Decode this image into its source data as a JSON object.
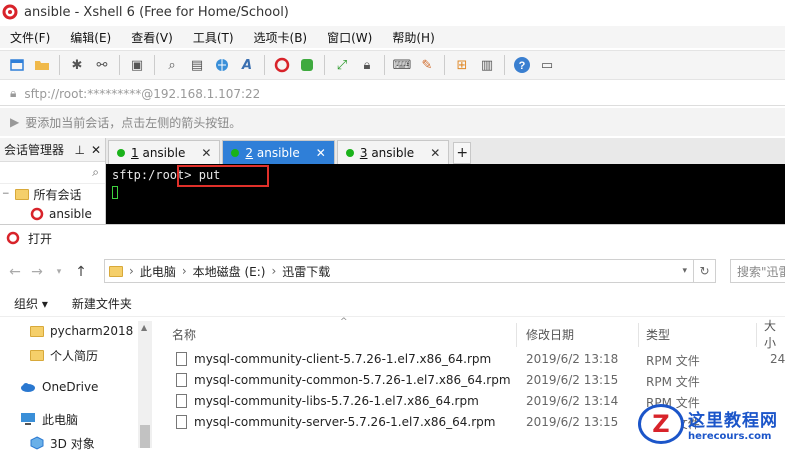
{
  "window": {
    "title": "ansible - Xshell 6 (Free for Home/School)"
  },
  "menu": [
    "文件(F)",
    "编辑(E)",
    "查看(V)",
    "工具(T)",
    "选项卡(B)",
    "窗口(W)",
    "帮助(H)"
  ],
  "address": {
    "value": "sftp://root:*********@192.168.1.107:22"
  },
  "hint": {
    "text": "要添加当前会话，点击左侧的箭头按钮。"
  },
  "session_manager": {
    "title": "会话管理器",
    "root_label": "所有会话",
    "item_label": "ansible"
  },
  "tabs": [
    {
      "num": "1",
      "label": "ansible",
      "active": false
    },
    {
      "num": "2",
      "label": "ansible",
      "active": true
    },
    {
      "num": "3",
      "label": "ansible",
      "active": false
    }
  ],
  "terminal": {
    "prompt": "sftp:/root>",
    "command": "put"
  },
  "dialog": {
    "title": "打开",
    "path": [
      "此电脑",
      "本地磁盘 (E:)",
      "迅雷下载"
    ],
    "search_placeholder": "搜索\"迅雷",
    "organize": "组织 ▾",
    "new_folder": "新建文件夹",
    "nav_items": [
      {
        "label": "pycharm2018",
        "icon": "folder-icon"
      },
      {
        "label": "个人简历",
        "icon": "folder-icon"
      },
      {
        "label": "OneDrive",
        "icon": "cloud-icon"
      },
      {
        "label": "此电脑",
        "icon": "computer-icon"
      },
      {
        "label": "3D 对象",
        "icon": "cube-icon"
      }
    ],
    "columns": {
      "name": "名称",
      "date": "修改日期",
      "type": "类型",
      "size": "大小"
    },
    "files": [
      {
        "name": "mysql-community-client-5.7.26-1.el7.x86_64.rpm",
        "date": "2019/6/2 13:18",
        "type": "RPM 文件",
        "size": "24"
      },
      {
        "name": "mysql-community-common-5.7.26-1.el7.x86_64.rpm",
        "date": "2019/6/2 13:15",
        "type": "RPM 文件",
        "size": ""
      },
      {
        "name": "mysql-community-libs-5.7.26-1.el7.x86_64.rpm",
        "date": "2019/6/2 13:14",
        "type": "RPM 文件",
        "size": ""
      },
      {
        "name": "mysql-community-server-5.7.26-1.el7.x86_64.rpm",
        "date": "2019/6/2 13:15",
        "type": "RPM 文件",
        "size": ""
      }
    ]
  },
  "watermark": {
    "cn": "这里教程网",
    "en": "herecours.com",
    "logo_letter": "Z"
  },
  "colors": {
    "accent": "#2f7fd8",
    "terminal_bg": "#000000",
    "highlight_box": "#e0302a"
  }
}
